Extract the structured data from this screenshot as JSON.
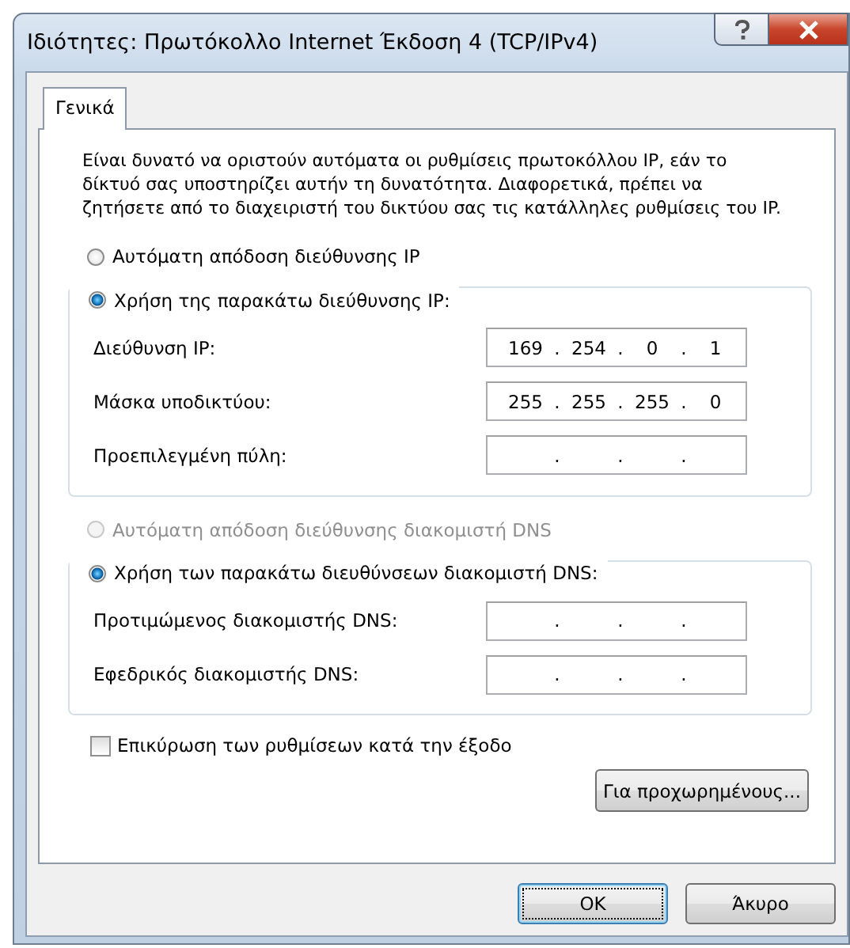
{
  "window": {
    "title": "Ιδιότητες: Πρωτόκολλο Internet Έκδοση 4 (TCP/IPv4)"
  },
  "tabs": [
    {
      "label": "Γενικά",
      "selected": true
    }
  ],
  "description": "Είναι δυνατό να οριστούν αυτόματα οι ρυθμίσεις πρωτοκόλλου IP, εάν το δίκτυό σας υποστηρίζει αυτήν τη δυνατότητα. Διαφορετικά, πρέπει να ζητήσετε από το διαχειριστή του δικτύου σας τις κατάλληλες ρυθμίσεις του IP.",
  "sections": [
    {
      "auto_option": {
        "label": "Αυτόματη απόδοση διεύθυνσης IP",
        "selected": false,
        "disabled": false
      },
      "manual_option": {
        "label": "Χρήση της παρακάτω διεύθυνσης IP:",
        "selected": true,
        "disabled": false
      },
      "fields": [
        {
          "label": "Διεύθυνση IP:",
          "octets": [
            "169",
            "254",
            "0",
            "1"
          ],
          "separators": [
            ".",
            ".",
            "."
          ]
        },
        {
          "label": "Μάσκα υποδικτύου:",
          "octets": [
            "255",
            "255",
            "255",
            "0"
          ],
          "separators": [
            ".",
            ".",
            "."
          ]
        },
        {
          "label": "Προεπιλεγμένη πύλη:",
          "separators": [
            ".",
            ".",
            "."
          ]
        }
      ]
    },
    {
      "auto_option": {
        "label": "Αυτόματη απόδοση διεύθυνσης διακομιστή DNS",
        "selected": false,
        "disabled": true
      },
      "manual_option": {
        "label": "Χρήση των παρακάτω διευθύνσεων διακομιστή DNS:",
        "selected": true,
        "disabled": false
      },
      "fields": [
        {
          "label": "Προτιμώμενος διακομιστής DNS:",
          "separators": [
            ".",
            ".",
            "."
          ]
        },
        {
          "label": "Εφεδρικός διακομιστής DNS:",
          "separators": [
            ".",
            ".",
            "."
          ]
        }
      ]
    }
  ],
  "checkbox": {
    "label": "Επικύρωση των ρυθμίσεων κατά την έξοδο",
    "checked": false
  },
  "advanced_button": "Για προχωρημένους...",
  "buttons": [
    {
      "label": "OK",
      "default": true
    },
    {
      "label": "Άκυρο",
      "default": false
    }
  ]
}
